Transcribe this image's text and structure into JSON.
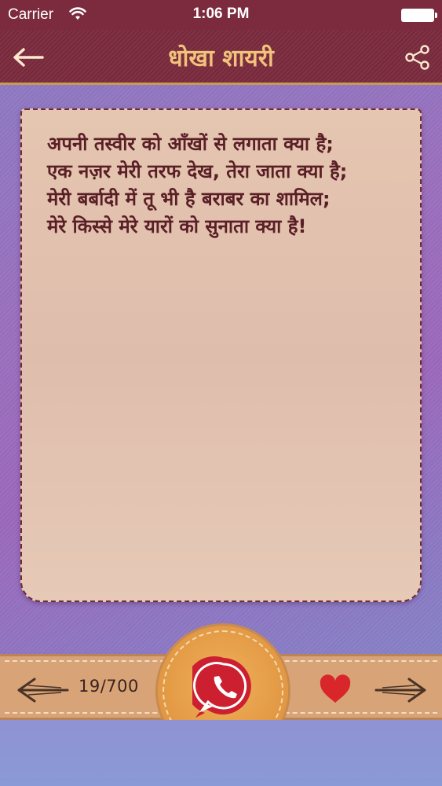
{
  "status_bar": {
    "carrier": "Carrier",
    "time": "1:06 PM",
    "icons": [
      "wifi-icon",
      "battery-icon"
    ]
  },
  "nav": {
    "title": "धोखा शायरी",
    "back_icon": "arrow-left-icon",
    "share_icon": "share-icon"
  },
  "quote": {
    "lines": [
      "अपनी तस्वीर को आँखों से लगाता क्या है;",
      "एक नज़र मेरी तरफ देख, तेरा जाता क्या है;",
      "मेरी बर्बादी में तू भी है बराबर का शामिल;",
      "मेरे किस्से मेरे यारों को सुनाता क्या है!"
    ]
  },
  "toolbar": {
    "counter": "19/700",
    "prev_icon": "arrow-left-icon",
    "next_icon": "arrow-right-icon",
    "favorite_icon": "heart-icon",
    "share_whatsapp_icon": "whatsapp-icon"
  },
  "colors": {
    "nav_bg": "#7c2b3e",
    "title": "#f0c27a",
    "card_bg": "#e5c6b0",
    "quote_text": "#5a1f26",
    "toolbar_bg": "#d8a477",
    "heart": "#d9262b",
    "whatsapp_red": "#cc2030"
  }
}
